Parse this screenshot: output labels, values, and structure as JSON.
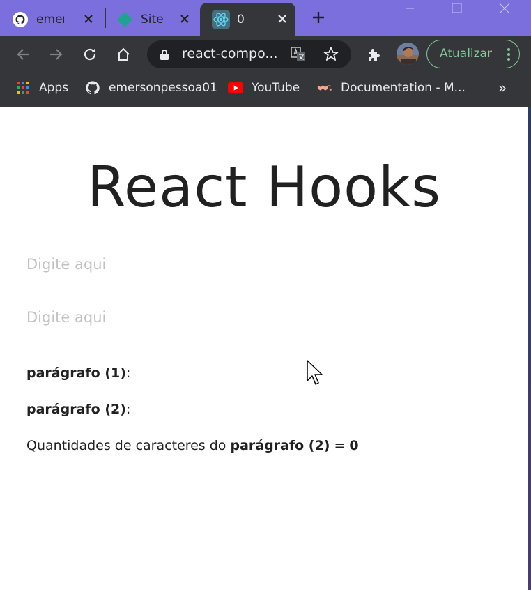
{
  "tabs": [
    {
      "title": "emer",
      "icon": "github-icon"
    },
    {
      "title": "Site c",
      "icon": "site-diamond-icon"
    },
    {
      "title": "0",
      "icon": "react-icon",
      "active": true
    }
  ],
  "toolbar": {
    "url": "react-compo...",
    "update_label": "Atualizar"
  },
  "bookmarks": [
    {
      "label": "Apps",
      "icon": "apps-grid-icon"
    },
    {
      "label": "emersonpessoa01",
      "icon": "github-icon"
    },
    {
      "label": "YouTube",
      "icon": "youtube-icon"
    },
    {
      "label": "Documentation - M...",
      "icon": "mui-icon"
    }
  ],
  "page": {
    "title": "React Hooks",
    "input1": {
      "placeholder": "Digite aqui",
      "value": ""
    },
    "input2": {
      "placeholder": "Digite aqui",
      "value": ""
    },
    "para1_label": "parágrafo (1)",
    "para1_suffix": ":",
    "para2_label": "parágrafo (2)",
    "para2_suffix": ":",
    "count_prefix": "Quantidades de caracteres do ",
    "count_label": "parágrafo (2)",
    "count_eq": " = ",
    "count_value": "0"
  },
  "colors": {
    "tabstrip": "#7b6fdd",
    "toolbar": "#35363a",
    "omnibox": "#202124",
    "update_accent": "#81c995"
  }
}
